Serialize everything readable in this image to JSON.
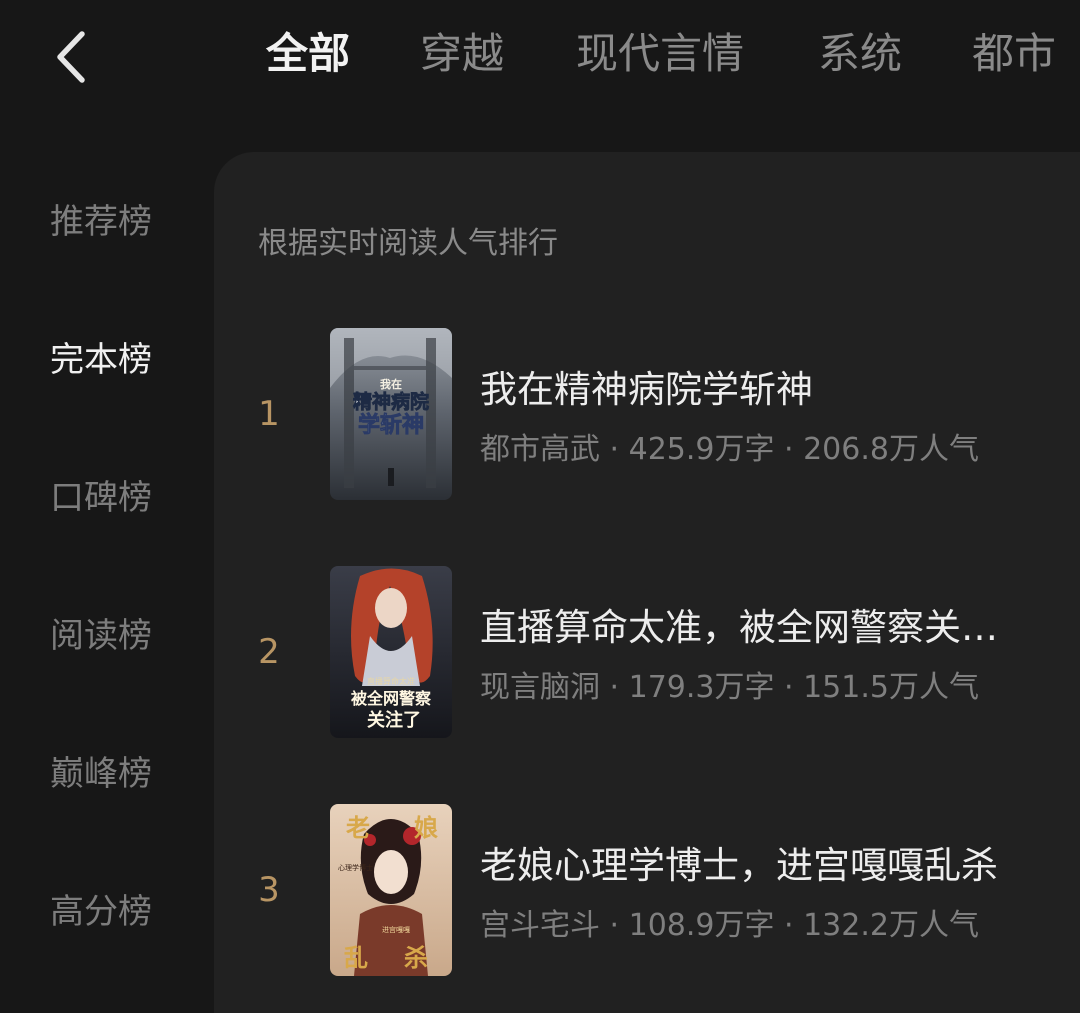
{
  "tabs": [
    {
      "label": "全部",
      "active": true
    },
    {
      "label": "穿越",
      "active": false
    },
    {
      "label": "现代言情",
      "active": false
    },
    {
      "label": "系统",
      "active": false
    },
    {
      "label": "都市",
      "active": false
    }
  ],
  "rank_nav": [
    {
      "label": "推荐榜",
      "active": false
    },
    {
      "label": "完本榜",
      "active": true
    },
    {
      "label": "口碑榜",
      "active": false
    },
    {
      "label": "阅读榜",
      "active": false
    },
    {
      "label": "巅峰榜",
      "active": false
    },
    {
      "label": "高分榜",
      "active": false
    }
  ],
  "panel": {
    "subtitle": "根据实时阅读人气排行"
  },
  "books": [
    {
      "rank": "1",
      "title": "我在精神病院学斩神",
      "meta": "都市高武 · 425.9万字 · 206.8万人气",
      "cover_text": [
        "我在",
        "精神病院",
        "学斩神"
      ]
    },
    {
      "rank": "2",
      "title": "直播算命太准，被全网警察关注了",
      "meta": "现言脑洞 · 179.3万字 · 151.5万人气",
      "cover_text": [
        "直播算命太准",
        "被全网警察",
        "关注了"
      ]
    },
    {
      "rank": "3",
      "title": "老娘心理学博士，进宫嘎嘎乱杀",
      "meta": "宫斗宅斗 · 108.9万字 · 132.2万人气",
      "cover_text": [
        "老",
        "娘",
        "心理学博士",
        "进宫嘎嘎",
        "乱",
        "杀"
      ]
    }
  ],
  "colors": {
    "background": "#171717",
    "panel": "#212121",
    "rank_number": "#b89564",
    "active_text": "#f0f0f0",
    "inactive_text": "#8a8a8a"
  },
  "icons": {
    "back": "chevron-left-icon"
  }
}
